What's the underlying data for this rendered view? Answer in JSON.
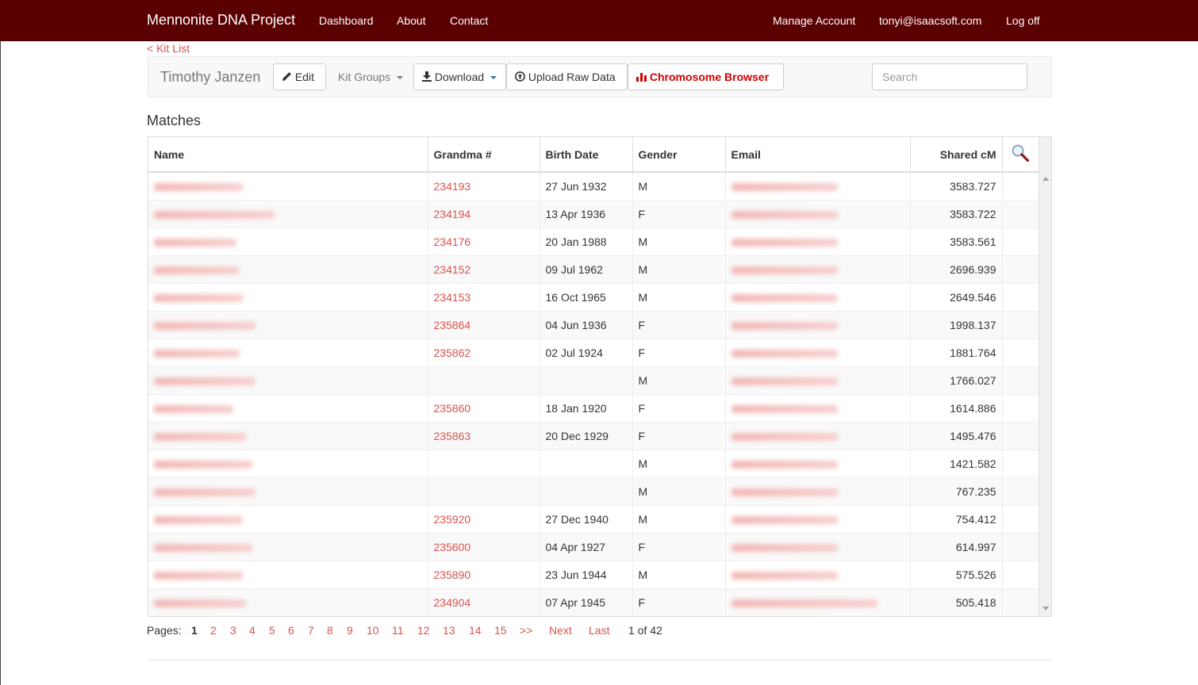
{
  "navbar": {
    "brand": "Mennonite DNA Project",
    "links": [
      "Dashboard",
      "About",
      "Contact"
    ],
    "right": {
      "manage": "Manage Account",
      "email": "tonyi@isaacsoft.com",
      "logout": "Log off"
    }
  },
  "breadcrumb": {
    "back": "< Kit List"
  },
  "toolbar": {
    "kit_name": "Timothy Janzen",
    "edit": "Edit",
    "kit_groups": "Kit Groups",
    "download": "Download",
    "upload": "Upload Raw Data",
    "chromosome": "Chromosome Browser",
    "search_placeholder": "Search"
  },
  "matches": {
    "title": "Matches",
    "columns": [
      "Name",
      "Grandma #",
      "Birth Date",
      "Gender",
      "Email",
      "Shared cM"
    ],
    "rows": [
      {
        "grandma": "234193",
        "birth": "27 Jun 1932",
        "gender": "M",
        "cm": "3583.727"
      },
      {
        "grandma": "234194",
        "birth": "13 Apr 1936",
        "gender": "F",
        "cm": "3583.722"
      },
      {
        "grandma": "234176",
        "birth": "20 Jan 1988",
        "gender": "M",
        "cm": "3583.561"
      },
      {
        "grandma": "234152",
        "birth": "09 Jul 1962",
        "gender": "M",
        "cm": "2696.939"
      },
      {
        "grandma": "234153",
        "birth": "16 Oct 1965",
        "gender": "M",
        "cm": "2649.546"
      },
      {
        "grandma": "235864",
        "birth": "04 Jun 1936",
        "gender": "F",
        "cm": "1998.137"
      },
      {
        "grandma": "235862",
        "birth": "02 Jul 1924",
        "gender": "F",
        "cm": "1881.764"
      },
      {
        "grandma": "",
        "birth": "",
        "gender": "M",
        "cm": "1766.027"
      },
      {
        "grandma": "235860",
        "birth": "18 Jan 1920",
        "gender": "F",
        "cm": "1614.886"
      },
      {
        "grandma": "235863",
        "birth": "20 Dec 1929",
        "gender": "F",
        "cm": "1495.476"
      },
      {
        "grandma": "",
        "birth": "",
        "gender": "M",
        "cm": "1421.582"
      },
      {
        "grandma": "",
        "birth": "",
        "gender": "M",
        "cm": "767.235"
      },
      {
        "grandma": "235920",
        "birth": "27 Dec 1940",
        "gender": "M",
        "cm": "754.412"
      },
      {
        "grandma": "235600",
        "birth": "04 Apr 1927",
        "gender": "F",
        "cm": "614.997"
      },
      {
        "grandma": "235890",
        "birth": "23 Jun 1944",
        "gender": "M",
        "cm": "575.526"
      },
      {
        "grandma": "234904",
        "birth": "07 Apr 1945",
        "gender": "F",
        "cm": "505.418"
      }
    ]
  },
  "pager": {
    "label": "Pages:",
    "pages": [
      "1",
      "2",
      "3",
      "4",
      "5",
      "6",
      "7",
      "8",
      "9",
      "10",
      "11",
      "12",
      "13",
      "14",
      "15"
    ],
    "more": ">>",
    "next": "Next",
    "last": "Last",
    "summary": "1 of 42"
  },
  "icons": {
    "edit": "pencil-icon",
    "download": "download-icon",
    "upload": "upload-icon",
    "chromosome": "bar-chart-icon",
    "table_search": "magnifier-icon"
  },
  "colors": {
    "navbar": "#5a0000",
    "link": "#d9534f",
    "chromosome_button": "#d00000",
    "download_caret": "#337ab7"
  }
}
